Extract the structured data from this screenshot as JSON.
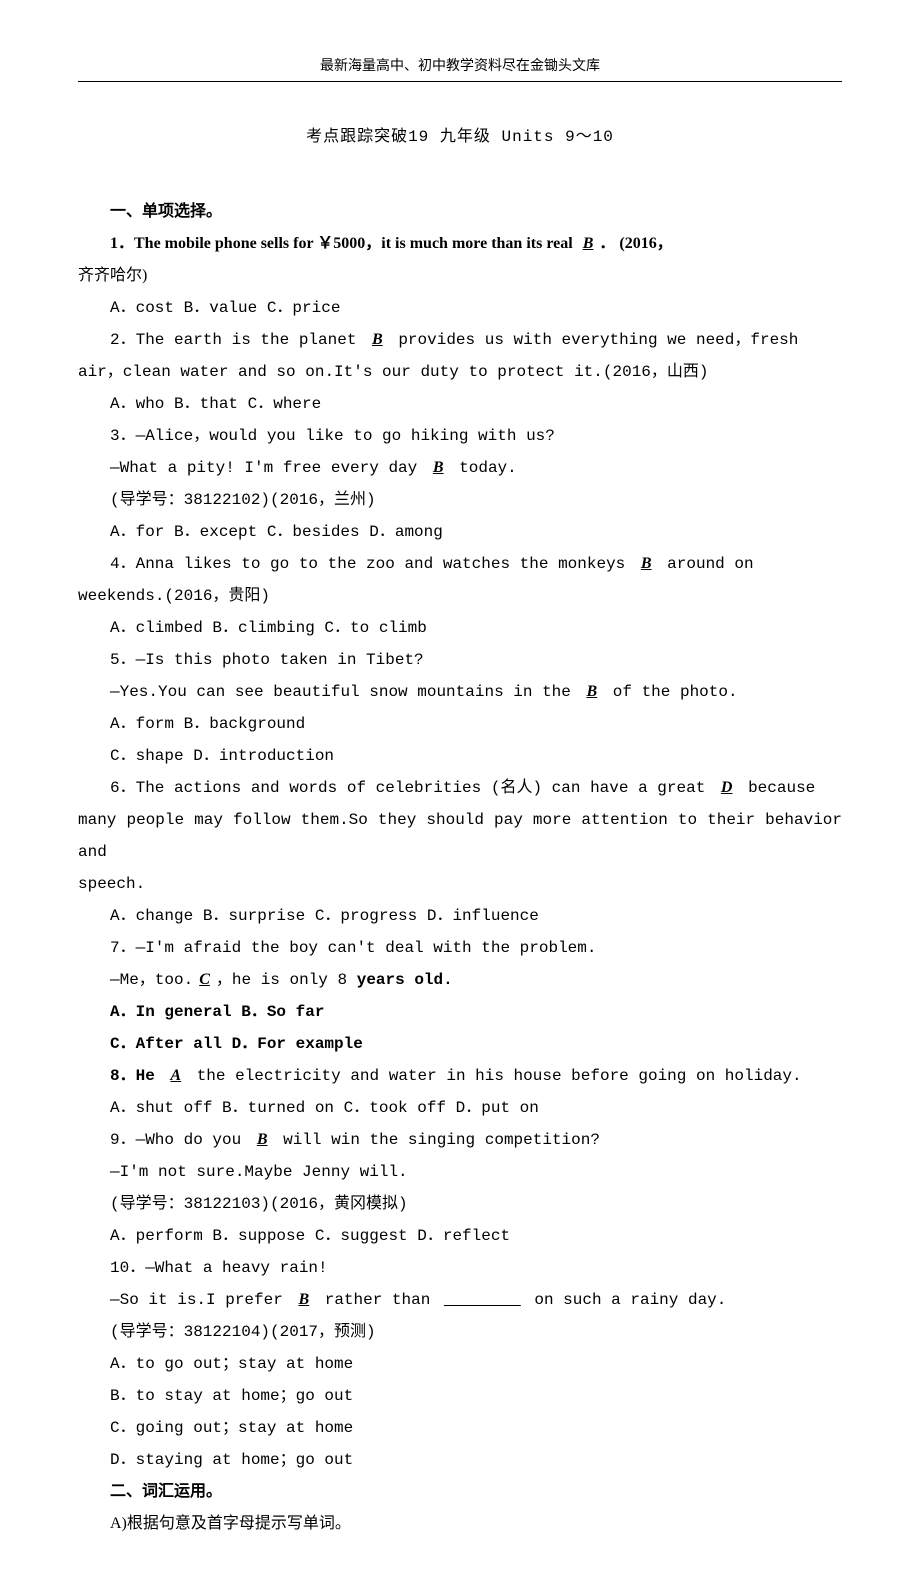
{
  "header": "最新海量高中、初中教学资料尽在金锄头文库",
  "title": "考点跟踪突破19  九年级 Units 9～10",
  "section1_title": "一、单项选择。",
  "q1_a": "1．The mobile phone sells for ￥5000，it is much more than its real ",
  "q1_ans": "B",
  "q1_b": "． (2016，",
  "q1_c": "齐齐哈尔)",
  "q1_opts": "A．cost      B．value      C．price",
  "q2_a": "2．The earth is the planet ",
  "q2_ans": "B",
  "q2_b": " provides us with everything we need，fresh",
  "q2_c": "air，clean water and so on.It's our duty to protect it.(2016，山西)",
  "q2_opts": "A．who  B．that  C．where",
  "q3_a": "3．—Alice，would you like to go hiking with us?",
  "q3_b": "—What a pity! I'm free every day ",
  "q3_ans": "B",
  "q3_c": " today.",
  "q3_d": "(导学号：38122102)(2016，兰州)",
  "q3_opts": "A．for  B．except  C．besides  D．among",
  "q4_a": "4．Anna likes to go to the zoo and watches the monkeys ",
  "q4_ans": "B",
  "q4_b": " around on",
  "q4_c": "weekends.(2016，贵阳)",
  "q4_opts": "A．climbed  B．climbing  C．to climb",
  "q5_a": "5．—Is this photo taken in Tibet?",
  "q5_b": "—Yes.You can see beautiful snow mountains in the ",
  "q5_ans": "B",
  "q5_c": " of the photo.",
  "q5_opts1": "A．form  B．background",
  "q5_opts2": "C．shape  D．introduction",
  "q6_a": "6．The actions and words of celebrities (名人) can have a great ",
  "q6_ans": "D",
  "q6_b": " because",
  "q6_c": "many people may follow them.So they should pay more attention to their behavior and",
  "q6_d": "speech.",
  "q6_opts": "A．change  B．surprise  C．progress  D．influence",
  "q7_a": "7．—I'm afraid the boy can't deal with the problem.",
  "q7_b": "—Me，too.",
  "q7_ans": "C",
  "q7_c": "，he is only 8 ",
  "q7_bold": "years old.",
  "q7_opts1": "A．In general  B．So far",
  "q7_opts2": "C．After all  D．For example",
  "q8_pre": "8．He ",
  "q8_ans": "A",
  "q8_a": " the electricity and water in his house before going on holiday.",
  "q8_opts": "A．shut off  B．turned on  C．took off  D．put on",
  "q9_a": "9．—Who do you ",
  "q9_ans": "B",
  "q9_b": " will win the singing competition?",
  "q9_c": "—I'm not sure.Maybe Jenny will.",
  "q9_d": "(导学号：38122103)(2016，黄冈模拟)",
  "q9_opts": "A．perform  B．suppose  C．suggest  D．reflect",
  "q10_a": "10．—What a heavy rain!",
  "q10_b": "—So it is.I prefer ",
  "q10_ans": "B",
  "q10_c": " rather than ",
  "q10_blank": "        ",
  "q10_d": " on such a rainy day.",
  "q10_e": "(导学号：38122104)(2017，预测)",
  "q10_opt_a": "A．to go out；stay at home",
  "q10_opt_b": "B．to stay at home；go out",
  "q10_opt_c": "C．going out；stay at home",
  "q10_opt_d": "D．staying at home；go out",
  "section2_title": "二、词汇运用。",
  "section2_sub": "A)根据句意及首字母提示写单词。"
}
